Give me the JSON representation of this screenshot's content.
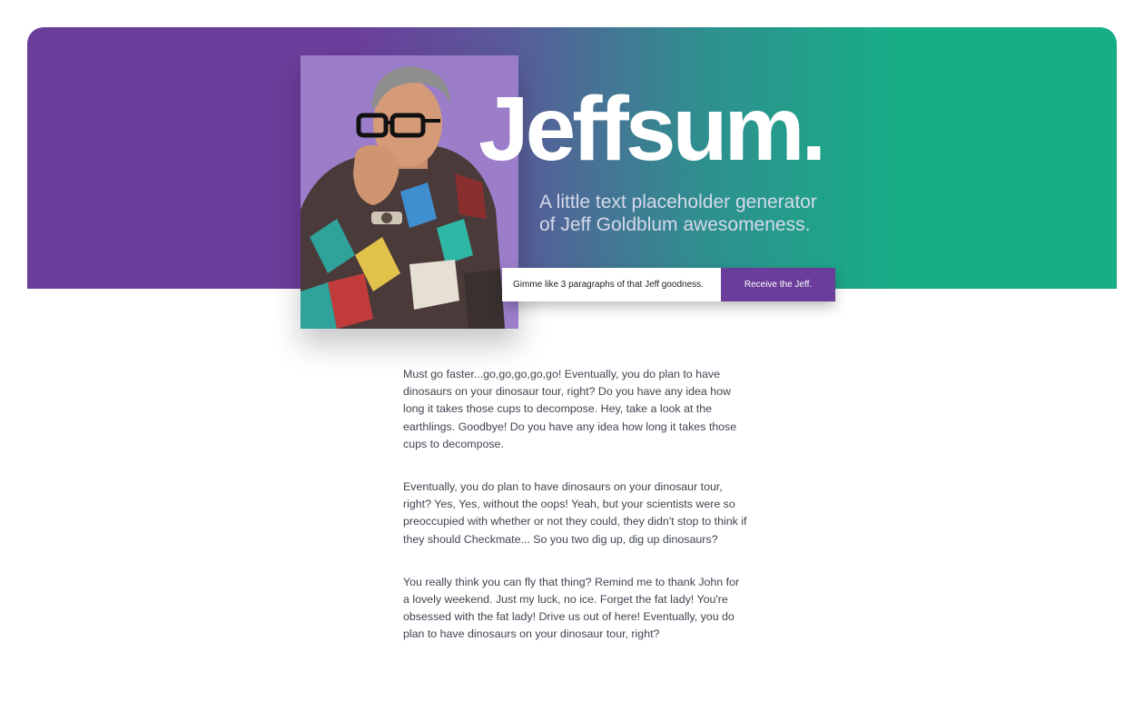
{
  "hero": {
    "title": "Jeffsum.",
    "subtitle_line1": "A little text placeholder generator",
    "subtitle_line2": "of Jeff Goldblum awesomeness."
  },
  "form": {
    "input_placeholder": "Gimme like 3 paragraphs of that Jeff goodness.",
    "submit_label": "Receive the Jeff."
  },
  "paragraphs": [
    "Must go faster...go,go,go,go,go! Eventually, you do plan to have dinosaurs on your dinosaur tour, right? Do you have any idea how long it takes those cups to decompose. Hey, take a look at the earthlings. Goodbye! Do you have any idea how long it takes those cups to decompose.",
    "Eventually, you do plan to have dinosaurs on your dinosaur tour, right? Yes, Yes, without the oops! Yeah, but your scientists were so preoccupied with whether or not they could, they didn't stop to think if they should Checkmate... So you two dig up, dig up dinosaurs?",
    "You really think you can fly that thing? Remind me to thank John for a lovely weekend. Just my luck, no ice. Forget the fat lady! You're obsessed with the fat lady! Drive us out of here! Eventually, you do plan to have dinosaurs on your dinosaur tour, right?"
  ],
  "colors": {
    "hero_purple": "#6b3e9b",
    "hero_green": "#17ae86",
    "button_purple": "#6a3d9a"
  }
}
